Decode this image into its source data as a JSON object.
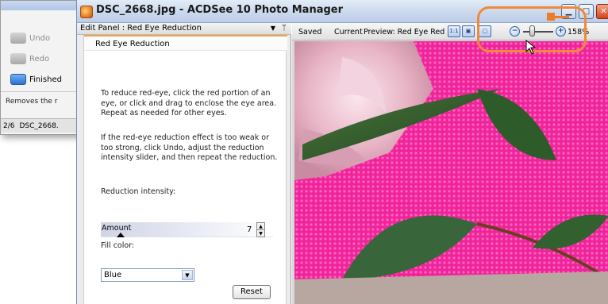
{
  "background_window": {
    "commands": [
      {
        "label": "Undo",
        "icon": "undo-icon"
      },
      {
        "label": "Redo",
        "icon": "redo-icon"
      },
      {
        "label": "Finished",
        "icon": "finished-icon"
      }
    ],
    "description": "Removes the r",
    "status": {
      "count": "2/6",
      "file": "DSC_2668."
    }
  },
  "window": {
    "title": "DSC_2668.jpg - ACDSee 10 Photo Manager",
    "controls": [
      "minimize",
      "maximize",
      "close"
    ]
  },
  "edit_panel": {
    "header": "Edit Panel : Red Eye Reduction",
    "section_title": "Red Eye Reduction",
    "instructions_1": "To reduce red-eye, click the red portion of an eye, or click and drag to enclose the eye area. Repeat as needed for other eyes.",
    "instructions_2": "If the red-eye reduction effect is too weak or too strong, click Undo, adjust the reduction intensity slider, and then repeat the reduction.",
    "intensity_label": "Reduction intensity:",
    "slider_name": "Amount",
    "slider_value": "7",
    "fill_label": "Fill color:",
    "fill_value": "Blue",
    "reset_label": "Reset"
  },
  "viewer": {
    "tabs": [
      "Saved",
      "Current"
    ],
    "preview_label": "Preview: Red Eye Red",
    "zoom_percent": "158%"
  },
  "colors": {
    "accent_orange": "#ef8a3a",
    "panel_bg": "#ececec",
    "title_bar": "#cfdcef"
  }
}
